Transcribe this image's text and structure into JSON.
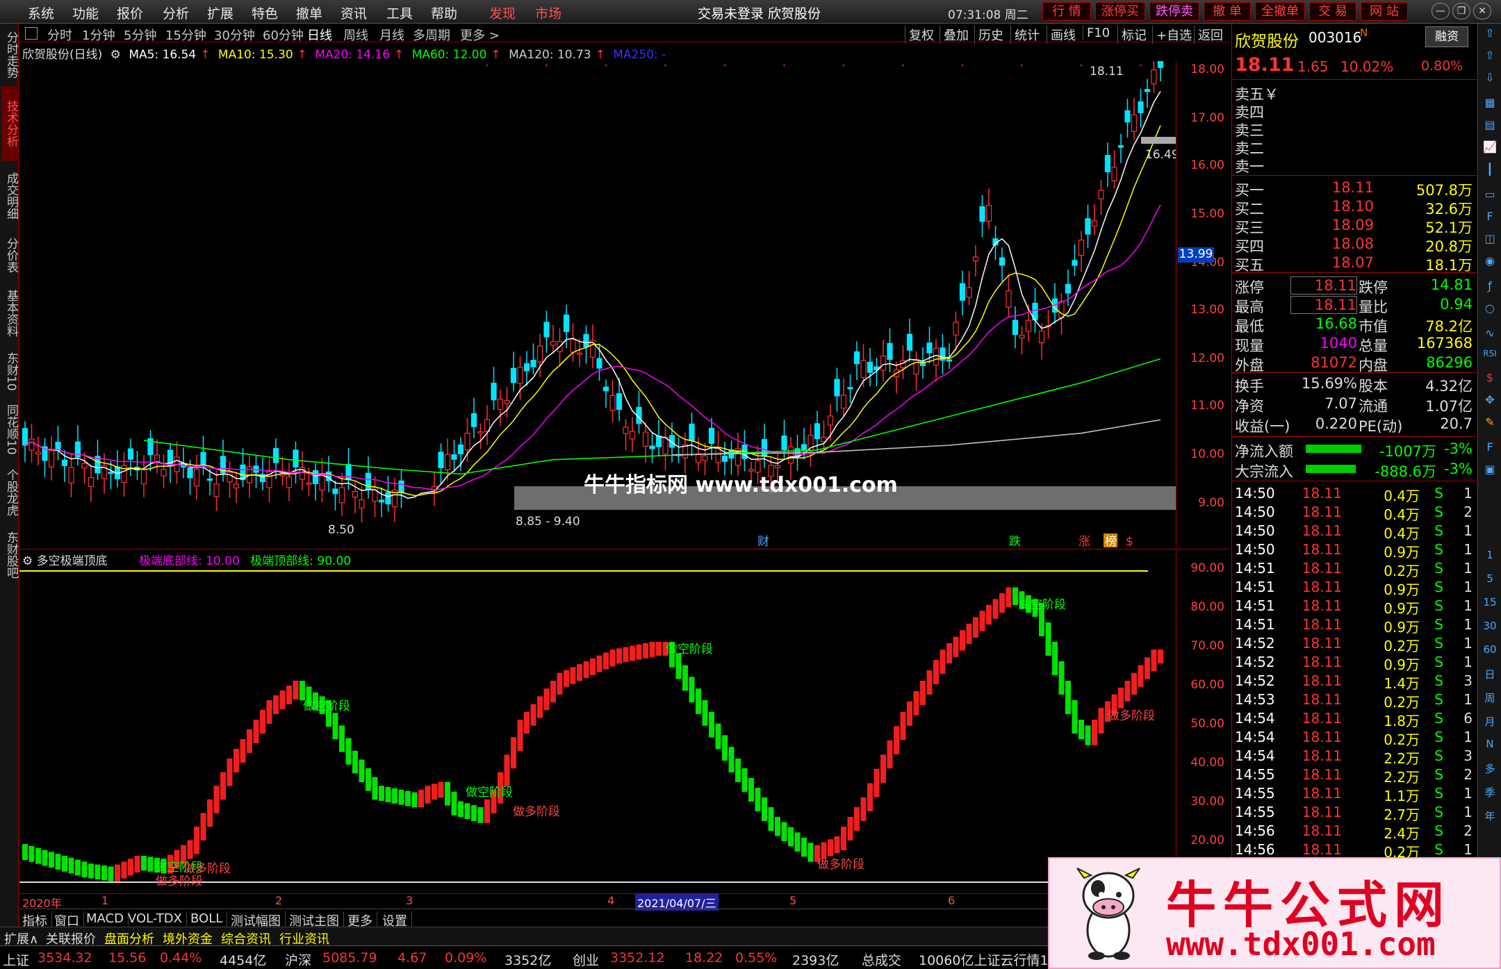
{
  "menu": {
    "items": [
      "系统",
      "功能",
      "报价",
      "分析",
      "扩展",
      "特色",
      "撤单",
      "资讯",
      "工具",
      "帮助"
    ],
    "discover": "发现",
    "market": "市场",
    "title": "交易未登录 欣贺股份",
    "clock": "07:31:08 周二",
    "actions": [
      "行 情",
      "涨停买",
      "跌停卖",
      "撤 单",
      "全撤单",
      "交 易",
      "网 站"
    ]
  },
  "left_tabs": [
    "分时走势",
    "技术分析",
    "成交明细",
    "分价表",
    "基本资料",
    "东财10",
    "同花顺10",
    "个股龙虎",
    "东财股吧"
  ],
  "periods": [
    "分时",
    "1分钟",
    "5分钟",
    "15分钟",
    "30分钟",
    "60分钟",
    "日线",
    "周线",
    "月线",
    "多周期",
    "更多 >"
  ],
  "right_tools": [
    "复权",
    "叠加",
    "历史",
    "统计",
    "画线",
    "F10",
    "标记",
    "+自选",
    "返回"
  ],
  "legend": {
    "name": "欣贺股份(日线)",
    "ma5": "MA5: 16.54",
    "ma10": "MA10: 15.30",
    "ma20": "MA20: 14.16",
    "ma60": "MA60: 12.00",
    "ma120": "MA120: 10.73",
    "ma250": "MA250: -"
  },
  "main_yaxis": [
    "18.00",
    "17.00",
    "16.00",
    "15.00",
    "14.00",
    "13.00",
    "12.00",
    "11.00",
    "10.00",
    "9.00"
  ],
  "price_tags": {
    "high": "18.11",
    "mark": "16.49",
    "cursor": "13.99",
    "low": "8.50",
    "range": "8.85 - 9.40"
  },
  "events": [
    "财",
    "跌",
    "涨",
    "榜",
    "$"
  ],
  "watermark": "牛牛指标网 www.tdx001.com",
  "sub": {
    "title": "多空极端顶底",
    "bottom_line": "极端底部线: 10.00",
    "top_line": "极端顶部线: 90.00",
    "yaxis": [
      "90.00",
      "80.00",
      "70.00",
      "60.00",
      "50.00",
      "40.00",
      "30.00",
      "20.00"
    ],
    "kong": "做空阶段",
    "duo": "做多阶段"
  },
  "dates": {
    "year": "2020年",
    "m1": "1",
    "m2": "2",
    "m3": "3",
    "m4": "4",
    "cursor": "2021/04/07/三",
    "m5": "5",
    "m6": "6"
  },
  "sub_tools": [
    "指标",
    "窗口",
    "MACD",
    "VOL-TDX",
    "BOLL",
    "测试幅图",
    "测试主图",
    "更多",
    "设置"
  ],
  "bottom_tabs": [
    "扩展∧",
    "关联报价",
    "盘面分析",
    "境外资金",
    "综合资讯",
    "行业资讯"
  ],
  "status": {
    "sh": "上证",
    "sh_val": "3534.32",
    "sh_chg": "15.56",
    "sh_pct": "0.44%",
    "sh_amt": "4454亿",
    "sz": "沪深",
    "sz_val": "5085.79",
    "sz_chg": "4.67",
    "sz_pct": "0.09%",
    "sz_amt": "3352亿",
    "cy": "创业",
    "cy_val": "3352.12",
    "cy_chg": "18.22",
    "cy_pct": "0.55%",
    "cy_amt": "2393亿",
    "total": "总成交",
    "total_val": "10060亿上证云行情1"
  },
  "quote": {
    "name": "欣贺股份",
    "code": "003016",
    "n": "N",
    "tag": "融资",
    "price": "18.11",
    "chg": "1.65",
    "pct": "10.02%",
    "spread": "0.80%",
    "sells": [
      "卖五￥",
      "卖四",
      "卖三",
      "卖二",
      "卖一"
    ],
    "buys": [
      {
        "l": "买一",
        "p": "18.11",
        "v": "507.8万"
      },
      {
        "l": "买二",
        "p": "18.10",
        "v": "32.6万"
      },
      {
        "l": "买三",
        "p": "18.09",
        "v": "52.1万"
      },
      {
        "l": "买四",
        "p": "18.08",
        "v": "20.8万"
      },
      {
        "l": "买五",
        "p": "18.07",
        "v": "18.1万"
      }
    ],
    "stats": [
      {
        "a": "涨停",
        "b": "18.11",
        "c": "跌停",
        "d": "14.81"
      },
      {
        "a": "最高",
        "b": "18.11",
        "c": "量比",
        "d": "0.94"
      },
      {
        "a": "最低",
        "b": "16.68",
        "c": "市值",
        "d": "78.2亿"
      },
      {
        "a": "现量",
        "b": "1040",
        "c": "总量",
        "d": "167368"
      },
      {
        "a": "外盘",
        "b": "81072",
        "c": "内盘",
        "d": "86296"
      }
    ],
    "stats2": [
      {
        "a": "换手",
        "b": "15.69%",
        "c": "股本",
        "d": "4.32亿"
      },
      {
        "a": "净资",
        "b": "7.07",
        "c": "流通",
        "d": "1.07亿"
      },
      {
        "a": "收益(一)",
        "b": "0.220",
        "c": "PE(动)",
        "d": "20.7"
      }
    ],
    "flows": [
      {
        "a": "净流入额",
        "v": "-1007万",
        "p": "-3%"
      },
      {
        "a": "大宗流入",
        "v": "-888.6万",
        "p": "-3%"
      }
    ],
    "ticks": [
      [
        "14:50",
        "18.11",
        "0.4万",
        "S",
        "1"
      ],
      [
        "14:50",
        "18.11",
        "0.4万",
        "S",
        "2"
      ],
      [
        "14:50",
        "18.11",
        "0.4万",
        "S",
        "1"
      ],
      [
        "14:50",
        "18.11",
        "0.9万",
        "S",
        "1"
      ],
      [
        "14:51",
        "18.11",
        "0.2万",
        "S",
        "1"
      ],
      [
        "14:51",
        "18.11",
        "0.9万",
        "S",
        "1"
      ],
      [
        "14:51",
        "18.11",
        "0.9万",
        "S",
        "1"
      ],
      [
        "14:51",
        "18.11",
        "0.9万",
        "S",
        "1"
      ],
      [
        "14:52",
        "18.11",
        "0.2万",
        "S",
        "1"
      ],
      [
        "14:52",
        "18.11",
        "0.9万",
        "S",
        "1"
      ],
      [
        "14:52",
        "18.11",
        "1.4万",
        "S",
        "3"
      ],
      [
        "14:53",
        "18.11",
        "0.2万",
        "S",
        "1"
      ],
      [
        "14:54",
        "18.11",
        "1.8万",
        "S",
        "6"
      ],
      [
        "14:54",
        "18.11",
        "0.2万",
        "S",
        "1"
      ],
      [
        "14:54",
        "18.11",
        "2.2万",
        "S",
        "3"
      ],
      [
        "14:55",
        "18.11",
        "2.2万",
        "S",
        "2"
      ],
      [
        "14:55",
        "18.11",
        "1.1万",
        "S",
        "1"
      ],
      [
        "14:55",
        "18.11",
        "2.7万",
        "S",
        "1"
      ],
      [
        "14:56",
        "18.11",
        "2.4万",
        "S",
        "2"
      ],
      [
        "14:56",
        "18.11",
        "0.2万",
        "S",
        "1"
      ]
    ]
  },
  "right_icons": [
    "1",
    "5",
    "15",
    "30",
    "60",
    "日",
    "周",
    "月",
    "N",
    "多",
    "季",
    "年"
  ],
  "ad": {
    "title": "牛牛公式网",
    "url": "www.tdx001.com"
  },
  "colors": {
    "up": "#ff3030",
    "down": "#00e5ff",
    "ma5": "#ffffff",
    "ma10": "#ffff00",
    "ma20": "#ff00ff",
    "ma60": "#00ff00",
    "ma120": "#c0c0c0",
    "duo": "#ff2020",
    "kong": "#00ee00"
  }
}
